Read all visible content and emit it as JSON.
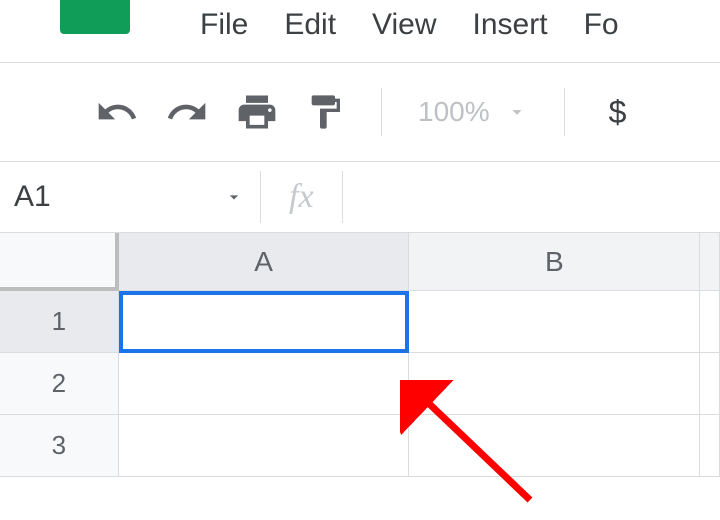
{
  "menu": {
    "file": "File",
    "edit": "Edit",
    "view": "View",
    "insert": "Insert",
    "format_partial": "Fo"
  },
  "toolbar": {
    "zoom": "100%",
    "currency": "$"
  },
  "namebox": {
    "value": "A1",
    "fx": "fx"
  },
  "columns": {
    "a": "A",
    "b": "B"
  },
  "rows": {
    "r1": "1",
    "r2": "2",
    "r3": "3"
  }
}
